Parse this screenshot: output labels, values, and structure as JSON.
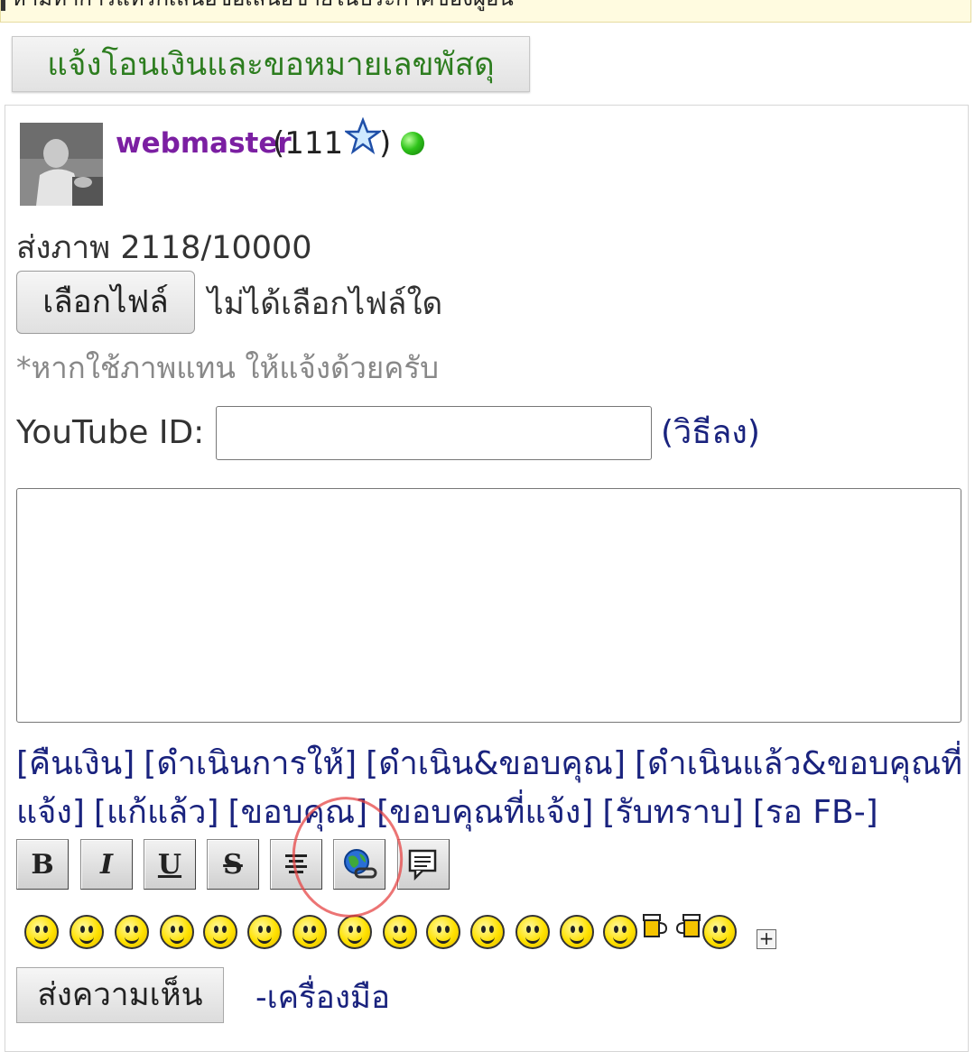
{
  "notice": {
    "text": "ห้ามทำการแทรกเสนอซื้อเสนอขายในประกาศของผู้อื่น"
  },
  "transfer_button": {
    "label": "แจ้งโอนเงินและขอหมายเลขพัสดุ"
  },
  "user": {
    "name": "webmaster",
    "score_open": "(111",
    "score_close": ")",
    "status_color": "#2fc41a"
  },
  "upload": {
    "count_text": "ส่งภาพ 2118/10000",
    "choose_file_label": "เลือกไฟล์",
    "no_file_text": "ไม่ได้เลือกไฟล์ใด",
    "hint": "*หากใช้ภาพแทน ให้แจ้งด้วยครับ"
  },
  "youtube": {
    "label": "YouTube ID:",
    "value": "",
    "howto": "(วิธีลง)"
  },
  "comment": {
    "value": ""
  },
  "quick_replies": [
    "[คืนเงิน]",
    "[ดำเนินการให้]",
    "[ดำเนิน&ขอบคุณ]",
    "[ดำเนินแล้ว&ขอบคุณที่แจ้ง]",
    "[แก้แล้ว]",
    "[ขอบคุณ]",
    "[ขอบคุณที่แจ้ง]",
    "[รับทราบ]",
    "[รอ FB-]"
  ],
  "toolbar": {
    "bold": "B",
    "italic": "I",
    "underline": "U",
    "strike": "S"
  },
  "emoji_more": "+",
  "actions": {
    "submit": "ส่งความเห็น",
    "tools": "-เครื่องมือ"
  },
  "colors": {
    "transfer_text": "#2d7d1f",
    "username": "#7b1fa2",
    "link": "#1a237e",
    "annotation": "#e64646"
  }
}
